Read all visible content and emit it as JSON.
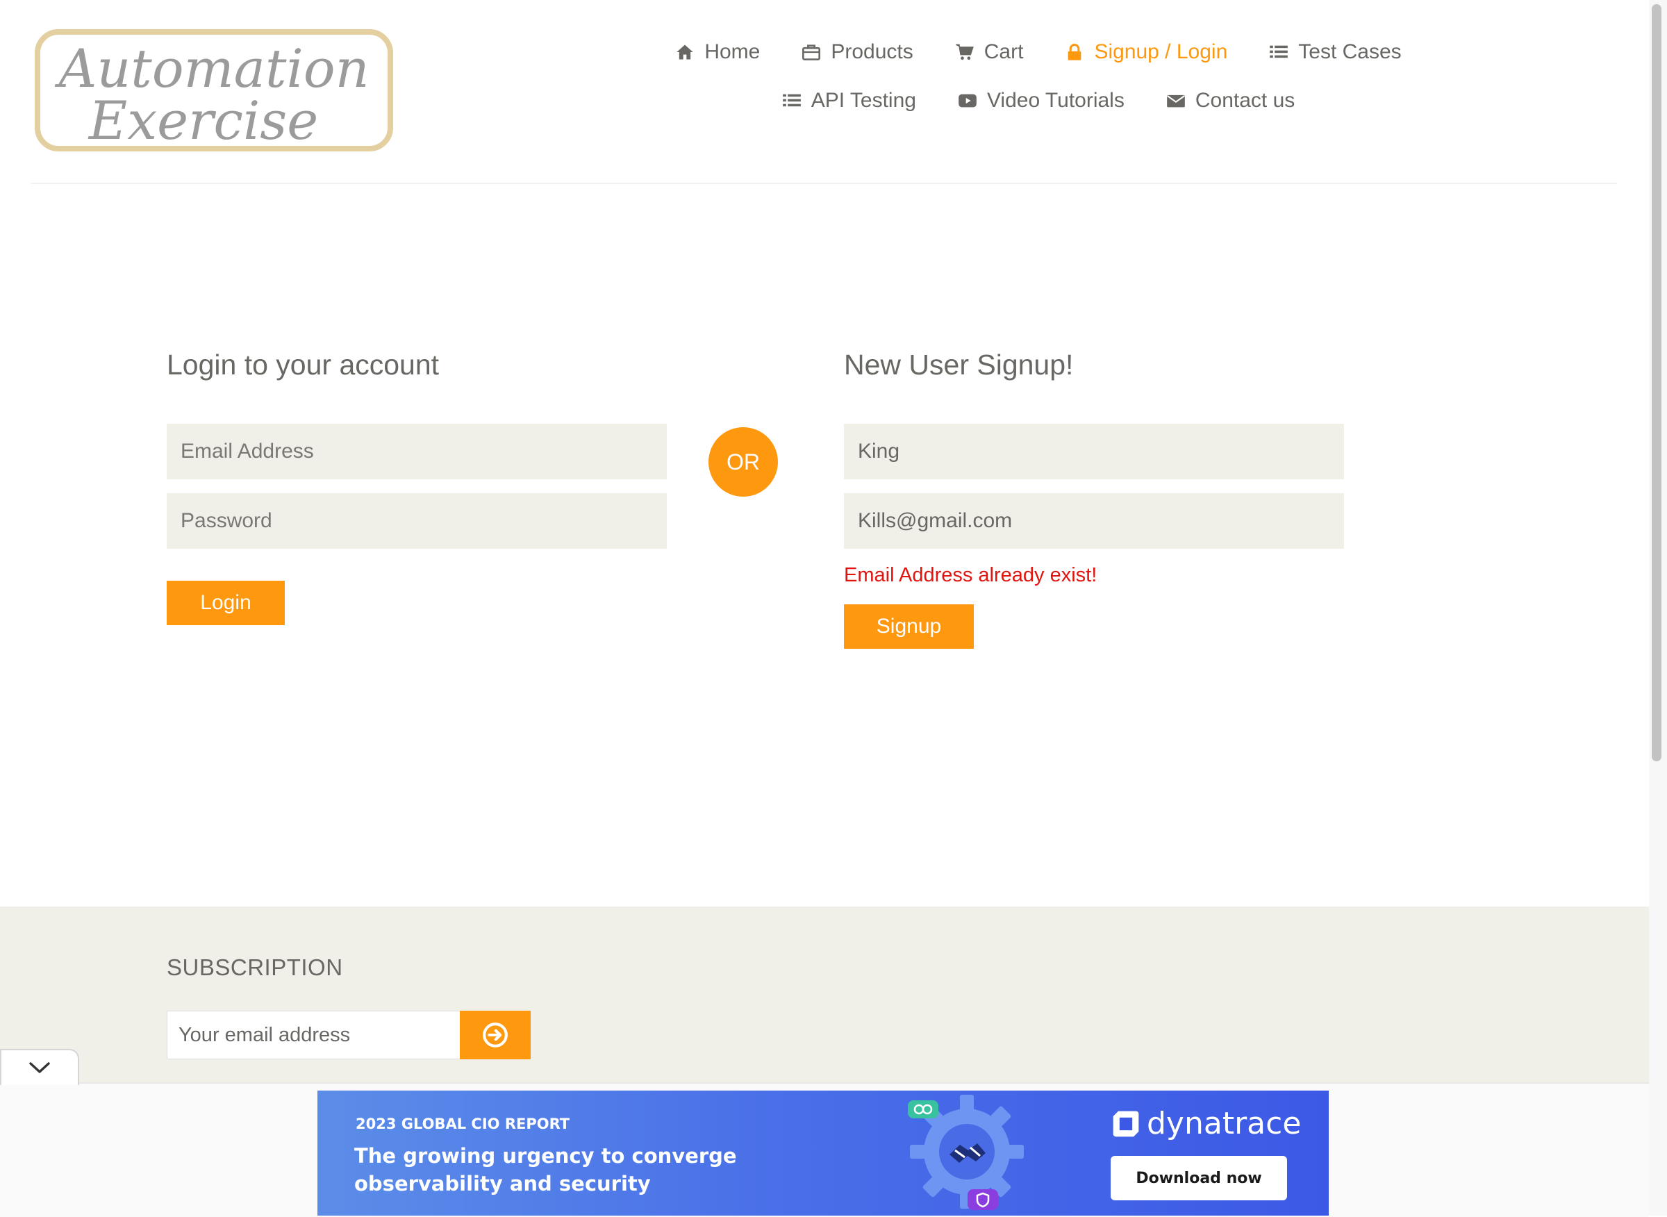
{
  "logo": {
    "line1": "Automation",
    "line2": "Exercise"
  },
  "nav": [
    {
      "label": "Home",
      "icon": "home-icon",
      "active": false
    },
    {
      "label": "Products",
      "icon": "briefcase-icon",
      "active": false
    },
    {
      "label": "Cart",
      "icon": "cart-icon",
      "active": false
    },
    {
      "label": "Signup / Login",
      "icon": "lock-icon",
      "active": true
    },
    {
      "label": "Test Cases",
      "icon": "list-icon",
      "active": false
    },
    {
      "label": "API Testing",
      "icon": "list-icon",
      "active": false
    },
    {
      "label": "Video Tutorials",
      "icon": "youtube-play-icon",
      "active": false
    },
    {
      "label": "Contact us",
      "icon": "envelope-icon",
      "active": false
    }
  ],
  "login": {
    "title": "Login to your account",
    "email_placeholder": "Email Address",
    "password_placeholder": "Password",
    "button": "Login"
  },
  "divider": {
    "label": "OR"
  },
  "signup": {
    "title": "New User Signup!",
    "name_value": "King",
    "email_value": "Kills@gmail.com",
    "error": "Email Address already exist!",
    "button": "Signup"
  },
  "subscription": {
    "title": "SUBSCRIPTION",
    "placeholder": "Your email address"
  },
  "ad": {
    "kicker": "2023 GLOBAL CIO REPORT",
    "headline": "The growing urgency to converge observability and security",
    "brand": "dynatrace",
    "cta": "Download now"
  },
  "colors": {
    "accent": "#fe980f",
    "text": "#696763",
    "field_bg": "#f0f0e9",
    "error": "#e0150f"
  }
}
